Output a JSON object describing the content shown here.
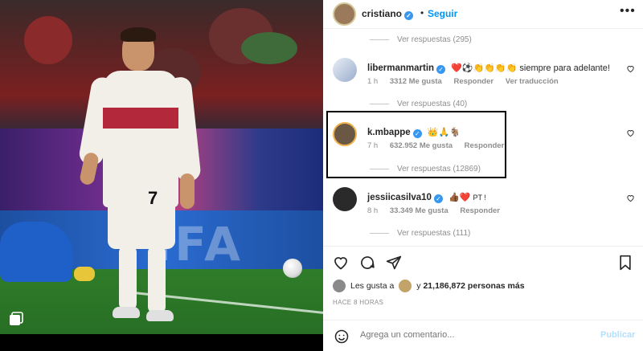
{
  "header": {
    "username": "cristiano",
    "follow_label": "Seguir",
    "more_label": "•••"
  },
  "replies_top": {
    "label": "Ver respuestas (295)"
  },
  "comments": [
    {
      "username": "libermanmartin",
      "verified": true,
      "text": "siempre para adelante!",
      "emojis": "❤️⚽👏👏👏👏",
      "time": "1 h",
      "likes": "3312 Me gusta",
      "reply_label": "Responder",
      "translate_label": "Ver traducción",
      "replies_label": "Ver respuestas (40)"
    },
    {
      "username": "k.mbappe",
      "verified": true,
      "text": "",
      "emojis": "👑🙏🐐",
      "time": "7 h",
      "likes": "632.952 Me gusta",
      "reply_label": "Responder",
      "replies_label": "Ver respuestas (12869)"
    },
    {
      "username": "jessiicasilva10",
      "verified": true,
      "text": "PT !",
      "emojis": "👍🏾❤️",
      "time": "8 h",
      "likes": "33.349 Me gusta",
      "reply_label": "Responder",
      "replies_label": "Ver respuestas (111)"
    }
  ],
  "likes_bar": {
    "prefix": "Les gusta a",
    "connector": "y",
    "count": "21,186,872 personas más"
  },
  "timestamp": "HACE 8 HORAS",
  "add_comment": {
    "placeholder": "Agrega un comentario...",
    "post_label": "Publicar"
  },
  "photo": {
    "jersey_number": "7",
    "board_text": "FIFA"
  },
  "colors": {
    "accent": "#0095f6",
    "verified": "#3897f0",
    "heart_red": "#ed4956",
    "highlight_box": "#000000"
  }
}
